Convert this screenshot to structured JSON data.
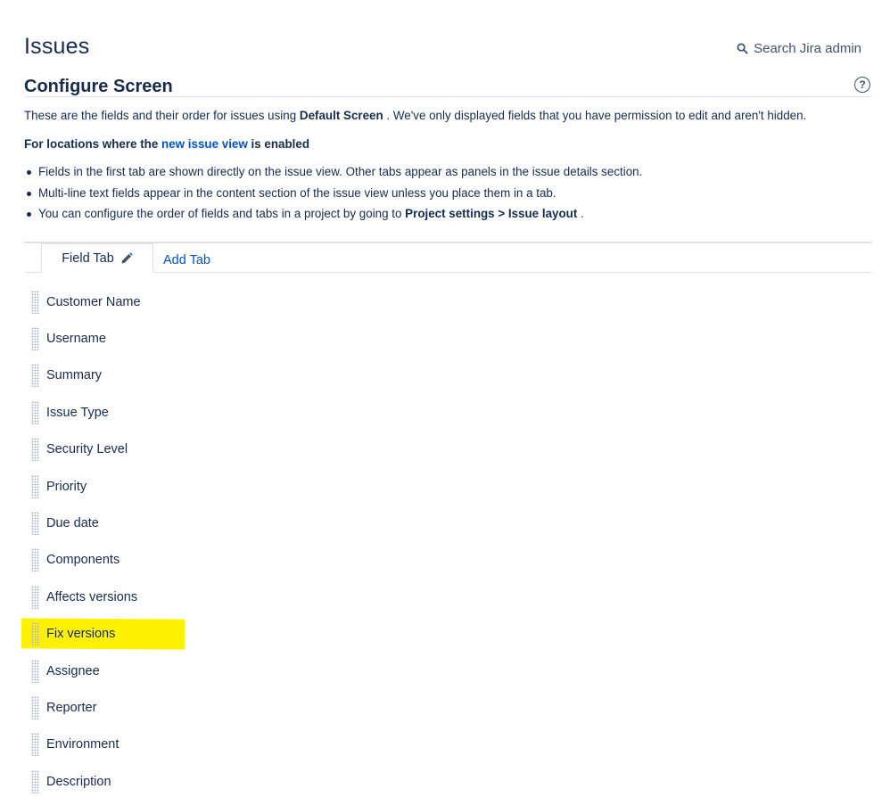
{
  "header": {
    "title": "Issues",
    "search_label": "Search Jira admin"
  },
  "section": {
    "title": "Configure Screen",
    "help_glyph": "?"
  },
  "intro": {
    "before": "These are the fields and their order for issues using ",
    "screen_name": "Default Screen",
    "after": " . We've only displayed fields that you have permission to edit and aren't hidden."
  },
  "locations": {
    "prefix": "For locations where the ",
    "link": "new issue view",
    "suffix": " is enabled"
  },
  "notes": {
    "items": [
      "Fields in the first tab are shown directly on the issue view. Other tabs appear as panels in the issue details section.",
      "Multi-line text fields appear in the content section of the issue view unless you place them in a tab."
    ],
    "project_note": {
      "before": "You can configure the order of fields and tabs in a project by going to ",
      "bold": "Project settings > Issue layout",
      "after": " ."
    }
  },
  "tabs": {
    "active_label": "Field Tab",
    "add_label": "Add Tab"
  },
  "fields": [
    "Customer Name",
    "Username",
    "Summary",
    "Issue Type",
    "Security Level",
    "Priority",
    "Due date",
    "Components",
    "Affects versions",
    "Fix versions",
    "Assignee",
    "Reporter",
    "Environment",
    "Description"
  ],
  "highlighted_field": "Fix versions",
  "colors": {
    "text": "#172b4d",
    "link": "#0052cc",
    "highlight": "#fff200",
    "rule": "#dfe1e6"
  }
}
